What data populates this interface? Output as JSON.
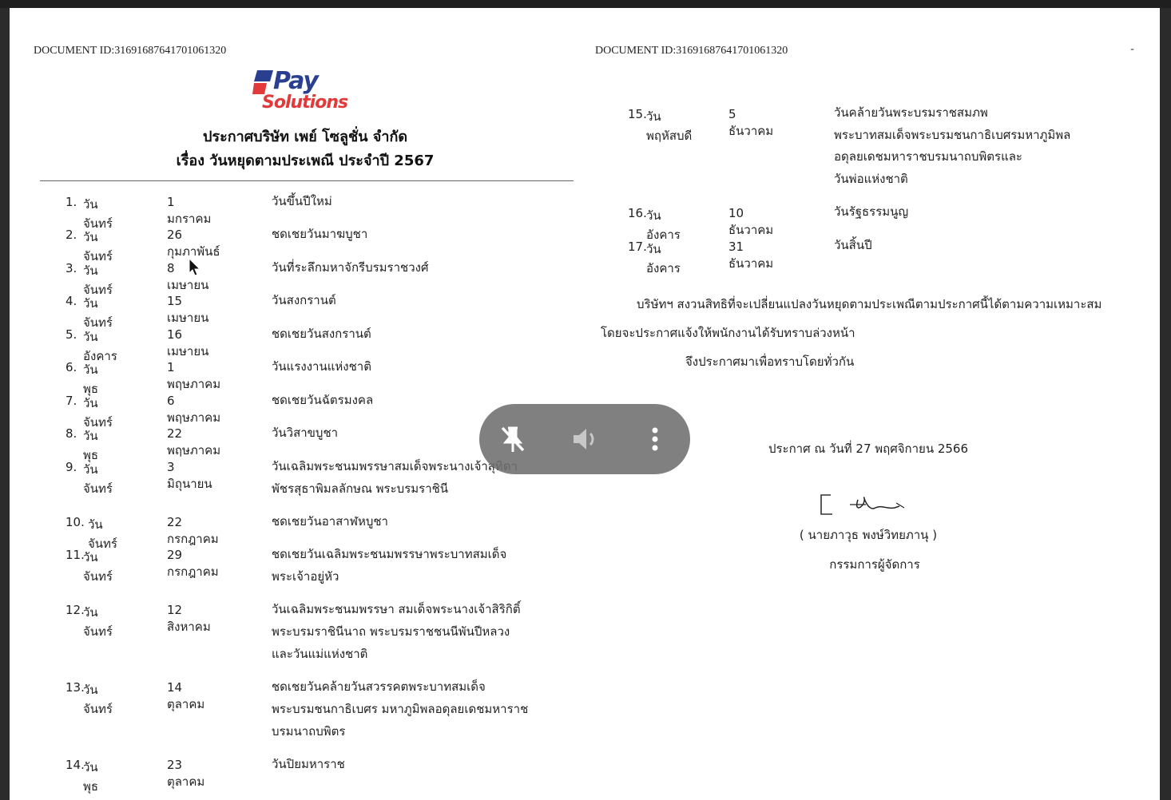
{
  "document": {
    "doc_id_left": "DOCUMENT ID:31691687641701061320",
    "doc_id_right": "DOCUMENT ID:31691687641701061320",
    "corner_mark": "-",
    "logo": {
      "word1": "Pay",
      "word2": "Solutions"
    },
    "title_line1": "ประกาศบริษัท เพย์ โซลูชั่น จำกัด",
    "title_line2": "เรื่อง วันหยุดตามประเพณี ประจำปี 2567"
  },
  "holidays": [
    {
      "no": "1.",
      "day": "วันจันทร์",
      "date": "1  มกราคม",
      "desc": [
        "วันขึ้นปีใหม่"
      ]
    },
    {
      "no": "2.",
      "day": "วันจันทร์",
      "date": "26  กุมภาพันธ์",
      "desc": [
        "ชดเชยวันมาฆบูชา"
      ]
    },
    {
      "no": "3.",
      "day": "วันจันทร์",
      "date": "8  เมษายน",
      "desc": [
        "วันที่ระลึกมหาจักรีบรมราชวงศ์"
      ]
    },
    {
      "no": "4.",
      "day": "วันจันทร์",
      "date": "15  เมษายน",
      "desc": [
        "วันสงกรานต์"
      ]
    },
    {
      "no": "5.",
      "day": "วันอังคาร",
      "date": "16  เมษายน",
      "desc": [
        "ชดเชยวันสงกรานต์"
      ]
    },
    {
      "no": "6.",
      "day": "วันพุธ",
      "date": "1  พฤษภาคม",
      "desc": [
        "วันแรงงานแห่งชาติ"
      ]
    },
    {
      "no": "7.",
      "day": "วันจันทร์",
      "date": "6  พฤษภาคม",
      "desc": [
        "ชดเชยวันฉัตรมงคล"
      ]
    },
    {
      "no": "8.",
      "day": "วันพุธ",
      "date": "22  พฤษภาคม",
      "desc": [
        "วันวิสาขบูชา"
      ]
    },
    {
      "no": "9.",
      "day": "วันจันทร์",
      "date": "3  มิถุนายน",
      "desc": [
        "วันเฉลิมพระชนมพรรษาสมเด็จพระนางเจ้าสุทิดา",
        "พัชรสุธาพิมลลักษณ พระบรมราชินี"
      ]
    },
    {
      "no": "10.",
      "day": "วันจันทร์",
      "date": "22  กรกฎาคม",
      "desc": [
        "ชดเชยวันอาสาฬหบูชา"
      ]
    },
    {
      "no": "11.",
      "day": "วันจันทร์",
      "date": "29  กรกฎาคม",
      "desc": [
        "ชดเชยวันเฉลิมพระชนมพรรษาพระบาทสมเด็จ",
        "พระเจ้าอยู่หัว"
      ]
    },
    {
      "no": "12.",
      "day": "วันจันทร์",
      "date": "12  สิงหาคม",
      "desc": [
        "วันเฉลิมพระชนมพรรษา สมเด็จพระนางเจ้าสิริกิติ์",
        "พระบรมราชินีนาถ พระบรมราชชนนีพันปีหลวง",
        "และวันแม่แห่งชาติ"
      ]
    },
    {
      "no": "13.",
      "day": "วันจันทร์",
      "date": "14  ตุลาคม",
      "desc": [
        "ชดเชยวันคล้ายวันสวรรคตพระบาทสมเด็จ",
        "พระบรมชนกาธิเบศร มหาภูมิพลอดุลยเดชมหาราช",
        "บรมนาถบพิตร"
      ]
    },
    {
      "no": "14.",
      "day": "วันพุธ",
      "date": "23  ตุลาคม",
      "desc": [
        "วันปิยมหาราช"
      ]
    }
  ],
  "holidays_right": [
    {
      "no": "15.",
      "day": "วันพฤหัสบดี",
      "date": "5  ธันวาคม",
      "desc": [
        "วันคล้ายวันพระบรมราชสมภพ",
        "พระบาทสมเด็จพระบรมชนกาธิเบศรมหาภูมิพล",
        "อดุลยเดชมหาราชบรมนาถบพิตรและ",
        "วันพ่อแห่งชาติ"
      ]
    },
    {
      "no": "16.",
      "day": "วันอังคาร",
      "date": "10  ธันวาคม",
      "desc": [
        "วันรัฐธรรมนูญ"
      ]
    },
    {
      "no": "17.",
      "day": "วันอังคาร",
      "date": "31  ธันวาคม",
      "desc": [
        "วันสิ้นปี"
      ]
    }
  ],
  "notice": {
    "line1": "บริษัทฯ  สงวนสิทธิที่จะเปลี่ยนแปลงวันหยุดตามประเพณีตามประกาศนี้ได้ตามความเหมาะสม",
    "line2": "โดยจะประกาศแจ้งให้พนักงานได้รับทราบล่วงหน้า",
    "line3": "จึงประกาศมาเพื่อทราบโดยทั่วกัน"
  },
  "signoff": {
    "announced": "ประกาศ ณ วันที่ 27 พฤศจิกายน  2566",
    "signer_name": "( นายภาวุธ  พงษ์วิทยภานุ )",
    "signer_title": "กรรมการผู้จัดการ"
  },
  "player": {
    "icons": [
      "pin-off-icon",
      "volume-icon",
      "more-vertical-icon"
    ]
  }
}
